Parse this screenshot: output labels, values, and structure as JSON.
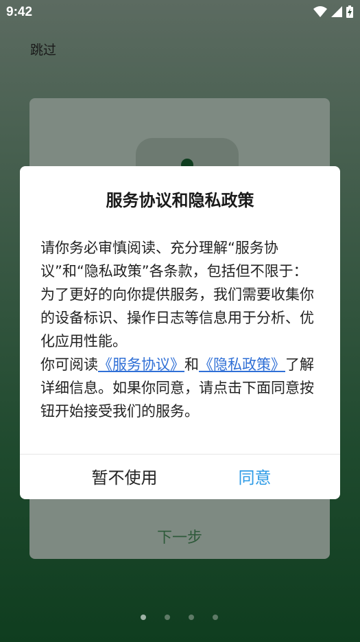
{
  "status_bar": {
    "time": "9:42",
    "icons": [
      "wifi-icon",
      "signal-icon",
      "battery-icon"
    ]
  },
  "header": {
    "skip_label": "跳过"
  },
  "card": {
    "next_label": "下一步"
  },
  "dialog": {
    "title": "服务协议和隐私政策",
    "body_intro": "请你务必审慎阅读、充分理解“服务协议”和“隐私政策”各条款，包括但不限于：为了更好的向你提供服务，我们需要收集你的设备标识、操作日志等信息用于分析、优化应用性能。",
    "body_prefix": "你可阅读",
    "link_service": "《服务协议》",
    "body_and": "和",
    "link_privacy": "《隐私政策》",
    "body_suffix": "了解详细信息。如果你同意，请点击下面同意按钮开始接受我们的服务。",
    "decline_label": "暂不使用",
    "agree_label": "同意"
  },
  "pager": {
    "total": 4,
    "active_index": 0
  },
  "colors": {
    "link": "#2f6fd6",
    "agree": "#2e9be6",
    "background_top": "#5c6b61",
    "background_bottom": "#0f3d1f"
  }
}
